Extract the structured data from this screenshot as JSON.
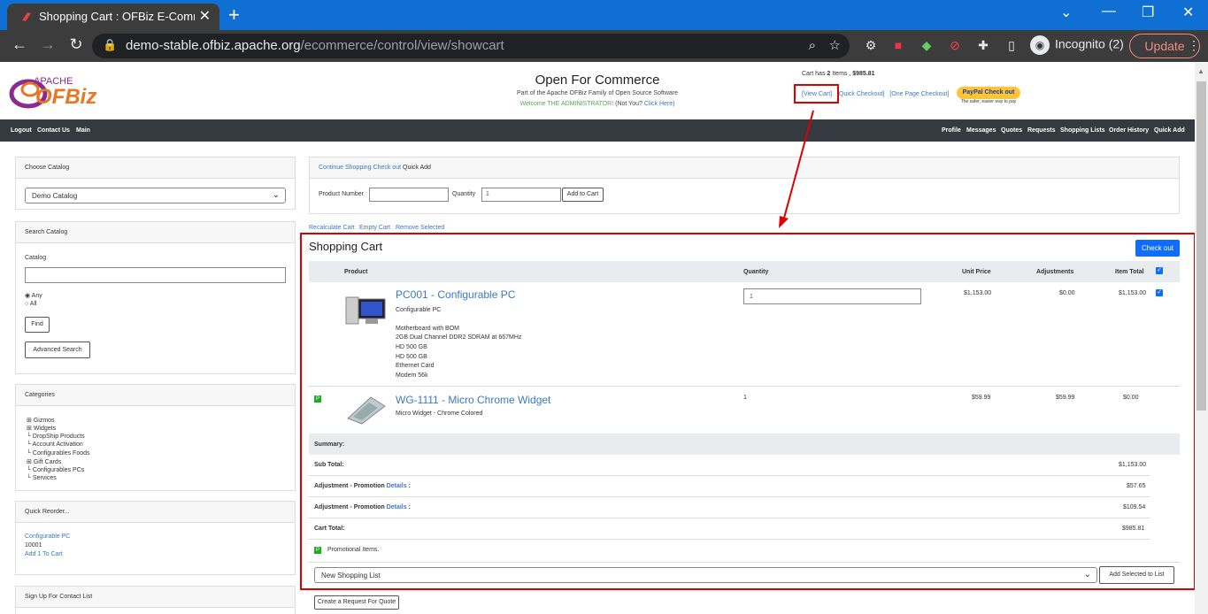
{
  "browser": {
    "tab_title": "Shopping Cart : OFBiz E-Commer",
    "url_host": "demo-stable.ofbiz.apache.org",
    "url_path": "/ecommerce/control/view/showcart",
    "incognito": "Incognito (2)",
    "update": "Update"
  },
  "header": {
    "logo_top": "APACHE",
    "logo_main": "OFBiz",
    "title": "Open For Commerce",
    "subtitle": "Part of the Apache OFBiz Family of Open Source Software",
    "welcome": "Welcome THE ADMINISTRATOR!",
    "not_you": "(Not You?",
    "click_here": "Click Here)",
    "cart_has_pre": "Cart has",
    "cart_count": "2",
    "cart_has_mid": "Items ,",
    "cart_total": "$985.81",
    "view_cart": "[View Cart]",
    "quick_checkout": "[Quick Checkout]",
    "one_page": "[One Page Checkout]",
    "paypal": "PayPal Check out",
    "paypal_sub": "The safer, easier way to pay"
  },
  "nav": {
    "left": [
      "Logout",
      "Contact Us",
      "Main"
    ],
    "right": [
      "Profile",
      "Messages",
      "Quotes",
      "Requests",
      "Shopping Lists",
      "Order History",
      "Quick Add"
    ]
  },
  "sidebar": {
    "choose_catalog": "Choose Catalog",
    "catalog_value": "Demo Catalog",
    "search_catalog": "Search Catalog",
    "catalog_label": "Catalog",
    "any": "Any",
    "all": "All",
    "find": "Find",
    "advanced": "Advanced Search",
    "categories": "Categories",
    "cat_items": [
      "Gizmos",
      "Widgets",
      "DropShip Products",
      "Account Activation",
      "Configurables Foods",
      "Gift Cards",
      "Configurables PCs",
      "Services"
    ],
    "quick_reorder": "Quick Reorder...",
    "reorder_name": "Configurable PC",
    "reorder_id": "10001",
    "reorder_add": "Add 1 To Cart",
    "signup": "Sign Up For Contact List"
  },
  "quickadd": {
    "continue": "Continue Shopping",
    "checkout": "Check out",
    "quick_add": "Quick Add",
    "product_number": "Product Number",
    "quantity": "Quantity",
    "qty_value": "1",
    "add_to_cart": "Add to Cart",
    "actions": [
      "Recalculate Cart",
      "Empty Cart",
      "Remove Selected"
    ]
  },
  "cart": {
    "title": "Shopping Cart",
    "checkout_btn": "Check out",
    "cols": [
      "Product",
      "Quantity",
      "Unit Price",
      "Adjustments",
      "Item Total"
    ],
    "items": [
      {
        "name": "PC001 - Configurable PC",
        "desc": "Configurable PC",
        "config": [
          "Motherboard with BOM",
          "2GB Dual Channel DDR2 SDRAM at 667MHz",
          "HD 500 GB",
          "HD 500 GB",
          "Ethernet Card",
          "Modem 56k"
        ],
        "qty": "1",
        "unit": "$1,153.00",
        "adj": "$0.00",
        "total": "$1,153.00"
      },
      {
        "name": "WG-1111 - Micro Chrome Widget",
        "desc": "Micro Widget - Chrome Colored",
        "qty": "1",
        "unit": "$59.99",
        "adj": "$59.99",
        "total": "$0.00"
      }
    ],
    "summary": "Summary:",
    "subtotal_label": "Sub Total:",
    "subtotal": "$1,153.00",
    "adj_label": "Adjustment - Promotion",
    "details": "Details",
    "adj1": "$57.65",
    "adj2": "$109.54",
    "cart_total_label": "Cart Total:",
    "cart_total": "$985.81",
    "promo": "Promotional Items.",
    "list_select": "New Shopping List",
    "add_selected": "Add Selected to List",
    "create_quote": "Create a Request For Quote"
  },
  "colors": {
    "accent": "#0d6efd",
    "annotation": "#dd0000",
    "link": "#3a78c3"
  }
}
